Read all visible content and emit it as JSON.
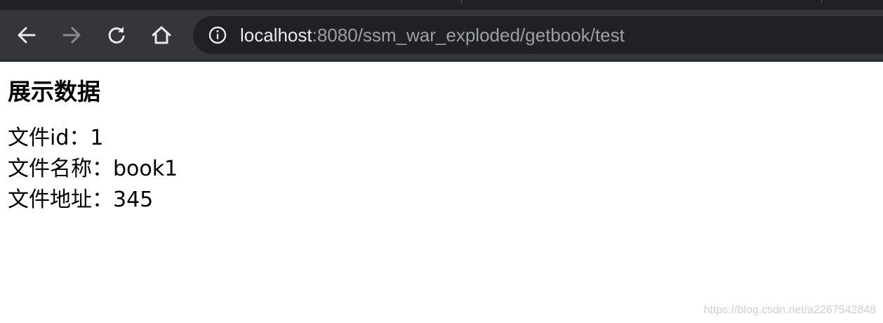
{
  "browser": {
    "url_host": "localhost",
    "url_rest": ":8080/ssm_war_exploded/getbook/test",
    "icons": {
      "back": "arrow-left-icon",
      "forward": "arrow-right-icon",
      "reload": "reload-icon",
      "home": "home-icon",
      "site_info": "info-icon"
    },
    "colors": {
      "chrome_bg": "#35363a",
      "omnibox_bg": "#202124",
      "url_host": "#e8eaed",
      "url_path": "#9aa0a6"
    }
  },
  "page": {
    "title": "展示数据",
    "rows": [
      {
        "label": "文件id：",
        "value": "1"
      },
      {
        "label": "文件名称：",
        "value": "book1"
      },
      {
        "label": "文件地址：",
        "value": "345"
      }
    ]
  },
  "watermark": "https://blog.csdn.net/a2267542848"
}
